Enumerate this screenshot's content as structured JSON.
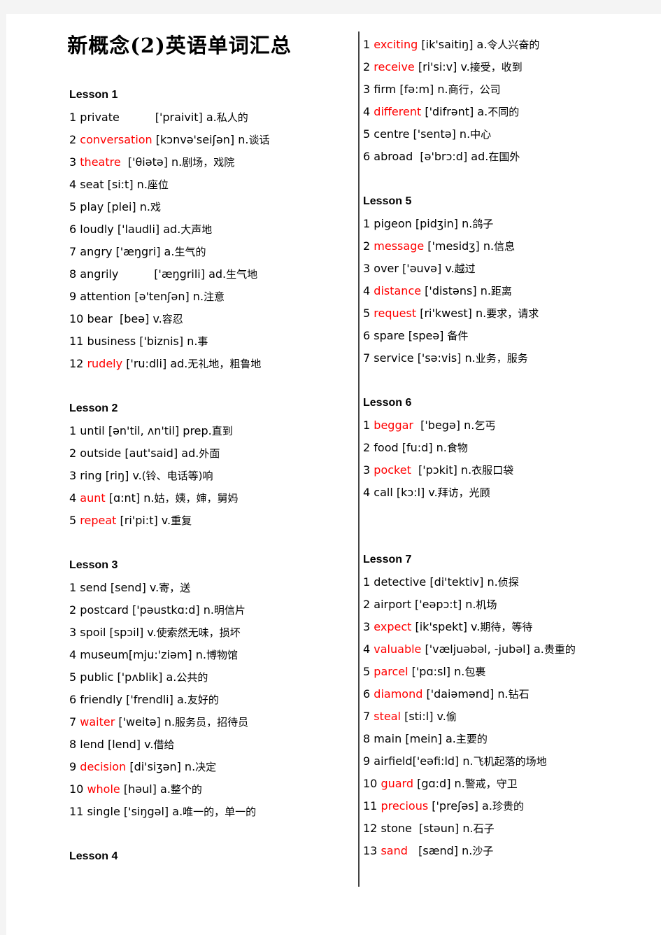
{
  "document": {
    "title": "新概念(2)英语单词汇总",
    "accent_red": "#ff0000",
    "text_color": "#000000",
    "page_background": "#ffffff",
    "canvas_background": "#f4f4f4"
  },
  "left_column": [
    {
      "type": "lesson",
      "label": "Lesson 1"
    },
    {
      "type": "entry",
      "num": "1",
      "word": "private",
      "red": false,
      "gap": "          ",
      "ipa": "['praivit]",
      "pos": "a.",
      "cn": "私人的"
    },
    {
      "type": "entry",
      "num": "2",
      "word": "conversation",
      "red": true,
      "gap": " ",
      "ipa": "[kɔnvə'seiʃən]",
      "pos": "n.",
      "cn": "谈话"
    },
    {
      "type": "entry",
      "num": "3",
      "word": "theatre",
      "red": true,
      "gap": "  ",
      "ipa": "['θiətə]",
      "pos": "n.",
      "cn": "剧场，戏院"
    },
    {
      "type": "entry",
      "num": "4",
      "word": "seat",
      "red": false,
      "gap": " ",
      "ipa": "[si:t]",
      "pos": "n.",
      "cn": "座位"
    },
    {
      "type": "entry",
      "num": "5",
      "word": "play",
      "red": false,
      "gap": " ",
      "ipa": "[plei]",
      "pos": "n.",
      "cn": "戏"
    },
    {
      "type": "entry",
      "num": "6",
      "word": "loudly",
      "red": false,
      "gap": " ",
      "ipa": "['laudli]",
      "pos": "ad.",
      "cn": "大声地"
    },
    {
      "type": "entry",
      "num": "7",
      "word": "angry",
      "red": false,
      "gap": " ",
      "ipa": "['æŋgri]",
      "pos": "a.",
      "cn": "生气的"
    },
    {
      "type": "entry",
      "num": "8",
      "word": "angrily",
      "red": false,
      "gap": "          ",
      "ipa": "['æŋgrili]",
      "pos": "ad.",
      "cn": "生气地"
    },
    {
      "type": "entry",
      "num": "9",
      "word": "attention",
      "red": false,
      "gap": " ",
      "ipa": "[ə'tenʃən]",
      "pos": "n.",
      "cn": "注意"
    },
    {
      "type": "entry",
      "num": "10",
      "word": "bear",
      "red": false,
      "gap": "  ",
      "ipa": "[beə]",
      "pos": "v.",
      "cn": "容忍"
    },
    {
      "type": "entry",
      "num": "11",
      "word": "business",
      "red": false,
      "gap": " ",
      "ipa": "['biznis]",
      "pos": "n.",
      "cn": "事"
    },
    {
      "type": "entry",
      "num": "12",
      "word": "rudely",
      "red": true,
      "gap": " ",
      "ipa": "['ru:dli]",
      "pos": "ad.",
      "cn": "无礼地，粗鲁地"
    },
    {
      "type": "spacer"
    },
    {
      "type": "lesson",
      "label": "Lesson 2"
    },
    {
      "type": "entry",
      "num": "1",
      "word": "until",
      "red": false,
      "gap": " ",
      "ipa": "[ən'til, ʌn'til]",
      "pos": "prep.",
      "cn": "直到"
    },
    {
      "type": "entry",
      "num": "2",
      "word": "outside",
      "red": false,
      "gap": " ",
      "ipa": "[aut'said]",
      "pos": "ad.",
      "cn": "外面"
    },
    {
      "type": "entry",
      "num": "3",
      "word": "ring",
      "red": false,
      "gap": " ",
      "ipa": "[riŋ]",
      "pos": "v.",
      "cn": "(铃、电话等)响"
    },
    {
      "type": "entry",
      "num": "4",
      "word": "aunt",
      "red": true,
      "gap": " ",
      "ipa": "[ɑ:nt]",
      "pos": "n.",
      "cn": "姑，姨，婶，舅妈"
    },
    {
      "type": "entry",
      "num": "5",
      "word": "repeat",
      "red": true,
      "gap": " ",
      "ipa": "[ri'pi:t]",
      "pos": "v.",
      "cn": "重复"
    },
    {
      "type": "spacer"
    },
    {
      "type": "lesson",
      "label": "Lesson 3"
    },
    {
      "type": "entry",
      "num": "1",
      "word": "send",
      "red": false,
      "gap": " ",
      "ipa": "[send]",
      "pos": "v.",
      "cn": "寄，送"
    },
    {
      "type": "entry",
      "num": "2",
      "word": "postcard",
      "red": false,
      "gap": " ",
      "ipa": "['pəustkɑ:d]",
      "pos": "n.",
      "cn": "明信片"
    },
    {
      "type": "entry",
      "num": "3",
      "word": "spoil",
      "red": false,
      "gap": " ",
      "ipa": "[spɔil]",
      "pos": "v.",
      "cn": "使索然无味，损坏"
    },
    {
      "type": "entry",
      "num": "4",
      "word": "museum",
      "red": false,
      "gap": "",
      "ipa": "[mju:'ziəm]",
      "pos": "n.",
      "cn": "博物馆"
    },
    {
      "type": "entry",
      "num": "5",
      "word": "public",
      "red": false,
      "gap": " ",
      "ipa": "['pʌblik]",
      "pos": "a.",
      "cn": "公共的"
    },
    {
      "type": "entry",
      "num": "6",
      "word": "friendly",
      "red": false,
      "gap": " ",
      "ipa": "['frendli]",
      "pos": "a.",
      "cn": "友好的"
    },
    {
      "type": "entry",
      "num": "7",
      "word": "waiter",
      "red": true,
      "gap": " ",
      "ipa": "['weitə]",
      "pos": "n.",
      "cn": "服务员，招待员"
    },
    {
      "type": "entry",
      "num": "8",
      "word": "lend",
      "red": false,
      "gap": " ",
      "ipa": "[lend]",
      "pos": "v.",
      "cn": "借给"
    },
    {
      "type": "entry",
      "num": "9",
      "word": "decision",
      "red": true,
      "gap": " ",
      "ipa": "[di'siʒən]",
      "pos": "n.",
      "cn": "决定"
    },
    {
      "type": "entry",
      "num": "10",
      "word": "whole",
      "red": true,
      "gap": " ",
      "ipa": "[həul]",
      "pos": "a.",
      "cn": "整个的"
    },
    {
      "type": "entry",
      "num": "11",
      "word": "single",
      "red": false,
      "gap": " ",
      "ipa": "['siŋgəl]",
      "pos": "a.",
      "cn": "唯一的，单一的"
    },
    {
      "type": "spacer"
    },
    {
      "type": "lesson",
      "label": "Lesson 4"
    }
  ],
  "right_column": [
    {
      "type": "entry",
      "num": "1",
      "word": "exciting",
      "red": true,
      "gap": " ",
      "ipa": "[ik'saitiŋ]",
      "pos": "a.",
      "cn": "令人兴奋的"
    },
    {
      "type": "entry",
      "num": "2",
      "word": "receive",
      "red": true,
      "gap": " ",
      "ipa": "[ri'si:v]",
      "pos": "v.",
      "cn": "接受，收到"
    },
    {
      "type": "entry",
      "num": "3",
      "word": "firm",
      "red": false,
      "gap": " ",
      "ipa": "[fə:m]",
      "pos": "n.",
      "cn": "商行，公司"
    },
    {
      "type": "entry",
      "num": "4",
      "word": "different",
      "red": true,
      "gap": " ",
      "ipa": "['difrənt]",
      "pos": "a.",
      "cn": "不同的"
    },
    {
      "type": "entry",
      "num": "5",
      "word": "centre",
      "red": false,
      "gap": " ",
      "ipa": "['sentə]",
      "pos": "n.",
      "cn": "中心"
    },
    {
      "type": "entry",
      "num": "6",
      "word": "abroad",
      "red": false,
      "gap": "  ",
      "ipa": "[ə'brɔ:d]",
      "pos": "ad.",
      "cn": "在国外"
    },
    {
      "type": "spacer"
    },
    {
      "type": "lesson",
      "label": "Lesson 5"
    },
    {
      "type": "entry",
      "num": "1",
      "word": "pigeon",
      "red": false,
      "gap": " ",
      "ipa": "[pidʒin]",
      "pos": "n.",
      "cn": "鸽子"
    },
    {
      "type": "entry",
      "num": "2",
      "word": "message",
      "red": true,
      "gap": " ",
      "ipa": "['mesidʒ]",
      "pos": "n.",
      "cn": "信息"
    },
    {
      "type": "entry",
      "num": "3",
      "word": "over",
      "red": false,
      "gap": " ",
      "ipa": "['əuvə]",
      "pos": "v.",
      "cn": "越过"
    },
    {
      "type": "entry",
      "num": "4",
      "word": "distance",
      "red": true,
      "gap": " ",
      "ipa": "['distəns]",
      "pos": "n.",
      "cn": "距离"
    },
    {
      "type": "entry",
      "num": "5",
      "word": "request",
      "red": true,
      "gap": " ",
      "ipa": "[ri'kwest]",
      "pos": "n.",
      "cn": "要求，请求"
    },
    {
      "type": "entry",
      "num": "6",
      "word": "spare",
      "red": false,
      "gap": " ",
      "ipa": "[speə]",
      "pos": "",
      "cn": "备件"
    },
    {
      "type": "entry",
      "num": "7",
      "word": "service",
      "red": false,
      "gap": " ",
      "ipa": "['sə:vis]",
      "pos": "n.",
      "cn": "业务，服务"
    },
    {
      "type": "spacer"
    },
    {
      "type": "lesson",
      "label": "Lesson 6"
    },
    {
      "type": "entry",
      "num": "1",
      "word": "beggar",
      "red": true,
      "gap": "  ",
      "ipa": "['begə]",
      "pos": "n.",
      "cn": "乞丐"
    },
    {
      "type": "entry",
      "num": "2",
      "word": "food",
      "red": false,
      "gap": " ",
      "ipa": "[fu:d]",
      "pos": "n.",
      "cn": "食物"
    },
    {
      "type": "entry",
      "num": "3",
      "word": "pocket",
      "red": true,
      "gap": "  ",
      "ipa": "['pɔkit]",
      "pos": "n.",
      "cn": "衣服口袋"
    },
    {
      "type": "entry",
      "num": "4",
      "word": "call",
      "red": false,
      "gap": " ",
      "ipa": "[kɔ:l]",
      "pos": "v.",
      "cn": "拜访，光顾"
    },
    {
      "type": "spacer"
    },
    {
      "type": "spacer"
    },
    {
      "type": "lesson",
      "label": "Lesson 7"
    },
    {
      "type": "entry",
      "num": "1",
      "word": "detective",
      "red": false,
      "gap": " ",
      "ipa": "[di'tektiv]",
      "pos": "n.",
      "cn": "侦探"
    },
    {
      "type": "entry",
      "num": "2",
      "word": "airport",
      "red": false,
      "gap": " ",
      "ipa": "['eəpɔ:t]",
      "pos": "n.",
      "cn": "机场"
    },
    {
      "type": "entry",
      "num": "3",
      "word": "expect",
      "red": true,
      "gap": " ",
      "ipa": "[ik'spekt]",
      "pos": "v.",
      "cn": "期待，等待"
    },
    {
      "type": "entry",
      "num": "4",
      "word": "valuable",
      "red": true,
      "gap": " ",
      "ipa": "['væljuəbəl, -jubəl]",
      "pos": "a.",
      "cn": "贵重的"
    },
    {
      "type": "entry",
      "num": "5",
      "word": "parcel",
      "red": true,
      "gap": " ",
      "ipa": "['pɑ:sl]",
      "pos": "n.",
      "cn": "包裹"
    },
    {
      "type": "entry",
      "num": "6",
      "word": "diamond",
      "red": true,
      "gap": " ",
      "ipa": "['daiəmənd]",
      "pos": "n.",
      "cn": "钻石"
    },
    {
      "type": "entry",
      "num": "7",
      "word": "steal",
      "red": true,
      "gap": " ",
      "ipa": "[sti:l]",
      "pos": "v.",
      "cn": "偷"
    },
    {
      "type": "entry",
      "num": "8",
      "word": "main",
      "red": false,
      "gap": " ",
      "ipa": "[mein]",
      "pos": "a.",
      "cn": "主要的"
    },
    {
      "type": "entry",
      "num": "9",
      "word": "airfield",
      "red": false,
      "gap": "",
      "ipa": "['eəfi:ld]",
      "pos": "n.",
      "cn": "飞机起落的场地"
    },
    {
      "type": "entry",
      "num": "10",
      "word": "guard",
      "red": true,
      "gap": " ",
      "ipa": "[gɑ:d]",
      "pos": "n.",
      "cn": "警戒，守卫"
    },
    {
      "type": "entry",
      "num": "11",
      "word": "precious",
      "red": true,
      "gap": " ",
      "ipa": "['preʃəs]",
      "pos": "a.",
      "cn": "珍贵的"
    },
    {
      "type": "entry",
      "num": "12",
      "word": "stone",
      "red": false,
      "gap": "  ",
      "ipa": "[stəun]",
      "pos": "n.",
      "cn": "石子"
    },
    {
      "type": "entry",
      "num": "13",
      "word": "sand",
      "red": true,
      "gap": "   ",
      "ipa": "[sænd]",
      "pos": "n.",
      "cn": "沙子"
    }
  ]
}
